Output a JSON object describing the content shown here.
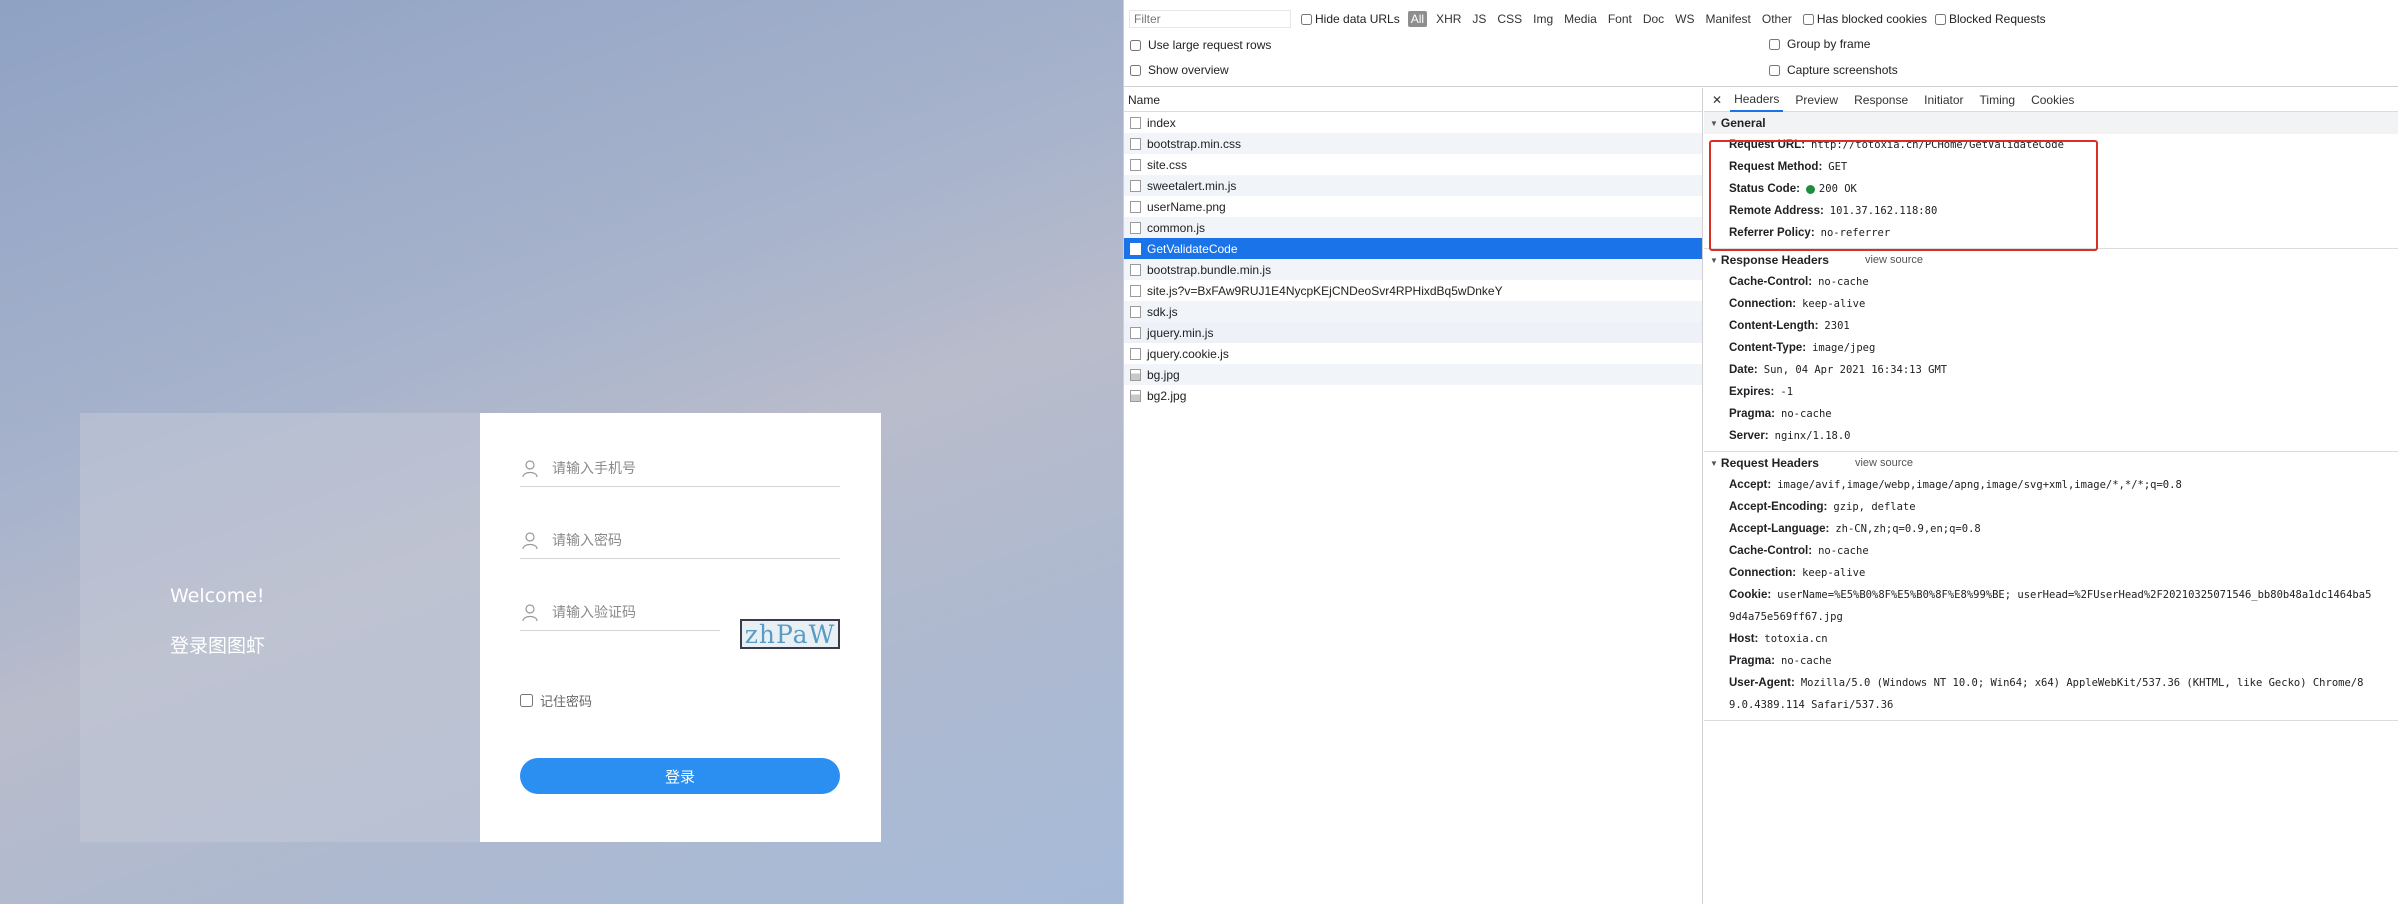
{
  "login": {
    "welcome": "Welcome!",
    "subtitle": "登录图图虾",
    "phone_placeholder": "请输入手机号",
    "password_placeholder": "请输入密码",
    "captcha_placeholder": "请输入验证码",
    "captcha_text": "zhPaW",
    "remember_label": "记住密码",
    "login_label": "登录"
  },
  "devtools": {
    "filter_placeholder": "Filter",
    "hide_data_urls": "Hide data URLs",
    "types": [
      "All",
      "XHR",
      "JS",
      "CSS",
      "Img",
      "Media",
      "Font",
      "Doc",
      "WS",
      "Manifest",
      "Other"
    ],
    "has_blocked_cookies": "Has blocked cookies",
    "blocked_requests": "Blocked Requests",
    "use_large_rows": "Use large request rows",
    "show_overview": "Show overview",
    "group_by_frame": "Group by frame",
    "capture_screenshots": "Capture screenshots",
    "name_header": "Name",
    "requests": [
      {
        "name": "index",
        "icon": "file"
      },
      {
        "name": "bootstrap.min.css",
        "icon": "file"
      },
      {
        "name": "site.css",
        "icon": "file"
      },
      {
        "name": "sweetalert.min.js",
        "icon": "file"
      },
      {
        "name": "userName.png",
        "icon": "file"
      },
      {
        "name": "common.js",
        "icon": "file"
      },
      {
        "name": "GetValidateCode",
        "icon": "file",
        "selected": true
      },
      {
        "name": "bootstrap.bundle.min.js",
        "icon": "file"
      },
      {
        "name": "site.js?v=BxFAw9RUJ1E4NycpKEjCNDeoSvr4RPHixdBq5wDnkeY",
        "icon": "file"
      },
      {
        "name": "sdk.js",
        "icon": "file"
      },
      {
        "name": "jquery.min.js",
        "icon": "file"
      },
      {
        "name": "jquery.cookie.js",
        "icon": "file"
      },
      {
        "name": "bg.jpg",
        "icon": "image"
      },
      {
        "name": "bg2.jpg",
        "icon": "image"
      }
    ],
    "tabs": [
      "Headers",
      "Preview",
      "Response",
      "Initiator",
      "Timing",
      "Cookies"
    ],
    "general_title": "General",
    "general": [
      {
        "key": "Request URL:",
        "value": "http://totoxia.cn/PCHome/GetValidateCode"
      },
      {
        "key": "Request Method:",
        "value": "GET"
      },
      {
        "key": "Status Code:",
        "value": "200 OK"
      },
      {
        "key": "Remote Address:",
        "value": "101.37.162.118:80"
      },
      {
        "key": "Referrer Policy:",
        "value": "no-referrer"
      }
    ],
    "response_headers_title": "Response Headers",
    "view_source": "view source",
    "response_headers": [
      {
        "key": "Cache-Control:",
        "value": "no-cache"
      },
      {
        "key": "Connection:",
        "value": "keep-alive"
      },
      {
        "key": "Content-Length:",
        "value": "2301"
      },
      {
        "key": "Content-Type:",
        "value": "image/jpeg"
      },
      {
        "key": "Date:",
        "value": "Sun, 04 Apr 2021 16:34:13 GMT"
      },
      {
        "key": "Expires:",
        "value": "-1"
      },
      {
        "key": "Pragma:",
        "value": "no-cache"
      },
      {
        "key": "Server:",
        "value": "nginx/1.18.0"
      }
    ],
    "request_headers_title": "Request Headers",
    "request_headers": [
      {
        "key": "Accept:",
        "value": "image/avif,image/webp,image/apng,image/svg+xml,image/*,*/*;q=0.8"
      },
      {
        "key": "Accept-Encoding:",
        "value": "gzip, deflate"
      },
      {
        "key": "Accept-Language:",
        "value": "zh-CN,zh;q=0.9,en;q=0.8"
      },
      {
        "key": "Cache-Control:",
        "value": "no-cache"
      },
      {
        "key": "Connection:",
        "value": "keep-alive"
      },
      {
        "key": "Cookie:",
        "value": "userName=%E5%B0%8F%E5%B0%8F%E8%99%BE; userHead=%2FUserHead%2F20210325071546_bb80b48a1dc1464ba5",
        "cont": "9d4a75e569ff67.jpg"
      },
      {
        "key": "Host:",
        "value": "totoxia.cn"
      },
      {
        "key": "Pragma:",
        "value": "no-cache"
      },
      {
        "key": "User-Agent:",
        "value": "Mozilla/5.0 (Windows NT 10.0; Win64; x64) AppleWebKit/537.36 (KHTML, like Gecko) Chrome/8",
        "cont": "9.0.4389.114 Safari/537.36"
      }
    ],
    "colors": {
      "selected_row": "#1a73e8",
      "highlight_box": "#d93025",
      "login_button": "#2a8ff0"
    }
  }
}
